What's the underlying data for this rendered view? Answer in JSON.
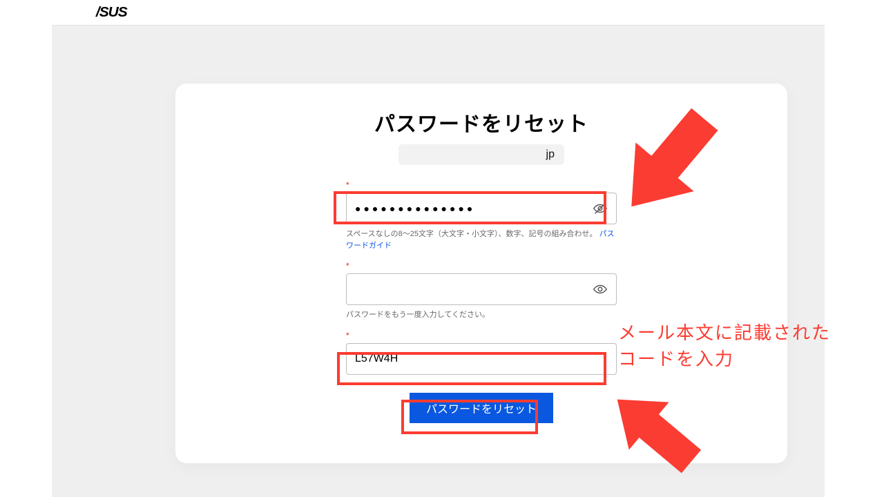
{
  "header": {
    "logo_text": "/SUS"
  },
  "card": {
    "title": "パスワードをリセット",
    "email_suffix": "jp",
    "fields": {
      "password": {
        "required_mark": "*",
        "value": "●●●●●●●●●●●●●●",
        "hint_text": "スペースなしの8～25文字（大文字・小文字）、数字、記号の組み合わせ。",
        "guide_link": "パスワードガイド"
      },
      "confirm": {
        "required_mark": "*",
        "hint_text": "パスワードをもう一度入力してください。"
      },
      "code": {
        "required_mark": "*",
        "value": "L57W4H"
      }
    },
    "submit_label": "パスワードをリセット"
  },
  "annotations": {
    "text_line1": "メール本文に記載された",
    "text_line2": "コードを入力"
  }
}
